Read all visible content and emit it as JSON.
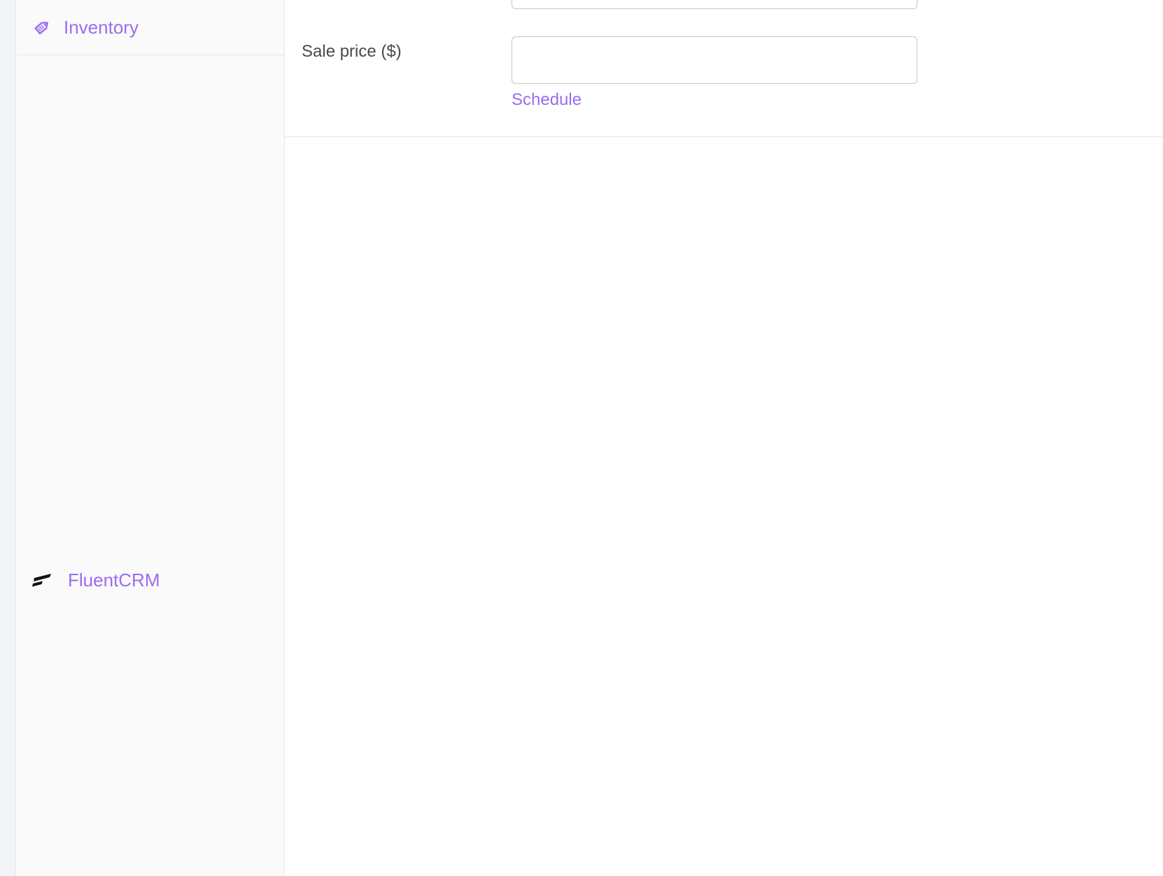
{
  "sidebar": {
    "items": [
      {
        "label": "Inventory",
        "icon": "price-tag-icon"
      },
      {
        "label": "FluentCRM",
        "icon": "fluentcrm-logo-icon"
      }
    ]
  },
  "general": {
    "sale_price_label": "Sale price ($)",
    "sale_price_value": "",
    "schedule_link": "Schedule"
  },
  "colors": {
    "accent": "#9b6cf0",
    "label_text": "#4a4a4a",
    "panel_bg": "#fafafa",
    "border": "#c7c7c7"
  }
}
